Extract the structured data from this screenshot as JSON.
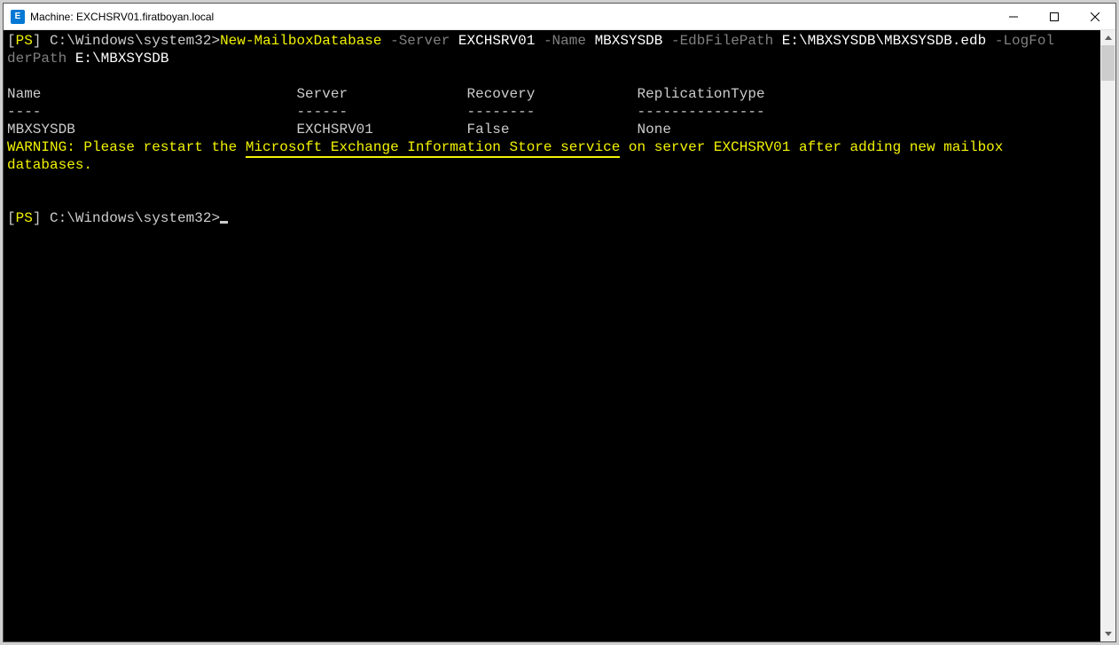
{
  "titlebar": {
    "icon_text": "E",
    "title": "Machine: EXCHSRV01.firatboyan.local"
  },
  "prompt": {
    "bracket_open": "[",
    "ps": "PS",
    "bracket_close": "]",
    "path": " C:\\Windows\\system32>"
  },
  "command": {
    "cmdlet": "New-MailboxDatabase",
    "p_server": " -Server ",
    "v_server": "EXCHSRV01",
    "p_name": " -Name ",
    "v_name": "MBXSYSDB",
    "p_edb": " -EdbFilePath ",
    "v_edb": "E:\\MBXSYSDB\\MBXSYSDB.edb",
    "p_log": " -LogFol",
    "p_log2": "derPath ",
    "v_log": "E:\\MBXSYSDB"
  },
  "table": {
    "hdr_name": "Name",
    "hdr_server": "Server",
    "hdr_recovery": "Recovery",
    "hdr_repl": "ReplicationType",
    "div_name": "----",
    "div_server": "------",
    "div_recovery": "--------",
    "div_repl": "---------------",
    "row_name": "MBXSYSDB",
    "row_server": "EXCHSRV01",
    "row_recovery": "False",
    "row_repl": "None"
  },
  "warning": {
    "pre": "WARNING: Please restart the ",
    "hl": "Microsoft Exchange Information Store service",
    "post1": " on server EXCHSRV01 after adding new mailbox",
    "post2": "databases."
  }
}
